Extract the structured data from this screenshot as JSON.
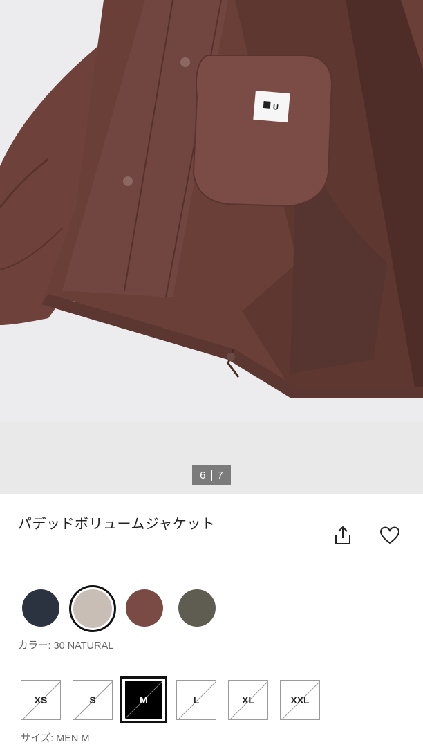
{
  "gallery": {
    "current": "6",
    "total": "7",
    "image_label_text": "U"
  },
  "product": {
    "title": "パデッドボリュームジャケット"
  },
  "actions": {
    "share_icon": "share-icon",
    "favorite_icon": "heart-icon"
  },
  "colors": {
    "label": "カラー: 30 NATURAL",
    "options": [
      {
        "hex": "#2b3240",
        "selected": false
      },
      {
        "hex": "#c9beb6",
        "selected": true
      },
      {
        "hex": "#7a4b44",
        "selected": false
      },
      {
        "hex": "#5f5c52",
        "selected": false
      }
    ]
  },
  "sizes": {
    "label": "サイズ: MEN M",
    "options": [
      {
        "label": "XS",
        "available": false,
        "selected": false
      },
      {
        "label": "S",
        "available": false,
        "selected": false
      },
      {
        "label": "M",
        "available": false,
        "selected": true
      },
      {
        "label": "L",
        "available": false,
        "selected": false
      },
      {
        "label": "XL",
        "available": false,
        "selected": false
      },
      {
        "label": "XXL",
        "available": false,
        "selected": false
      }
    ]
  },
  "theme": {
    "jacket_color": "#6b4039",
    "background": "#e9e9ea"
  }
}
